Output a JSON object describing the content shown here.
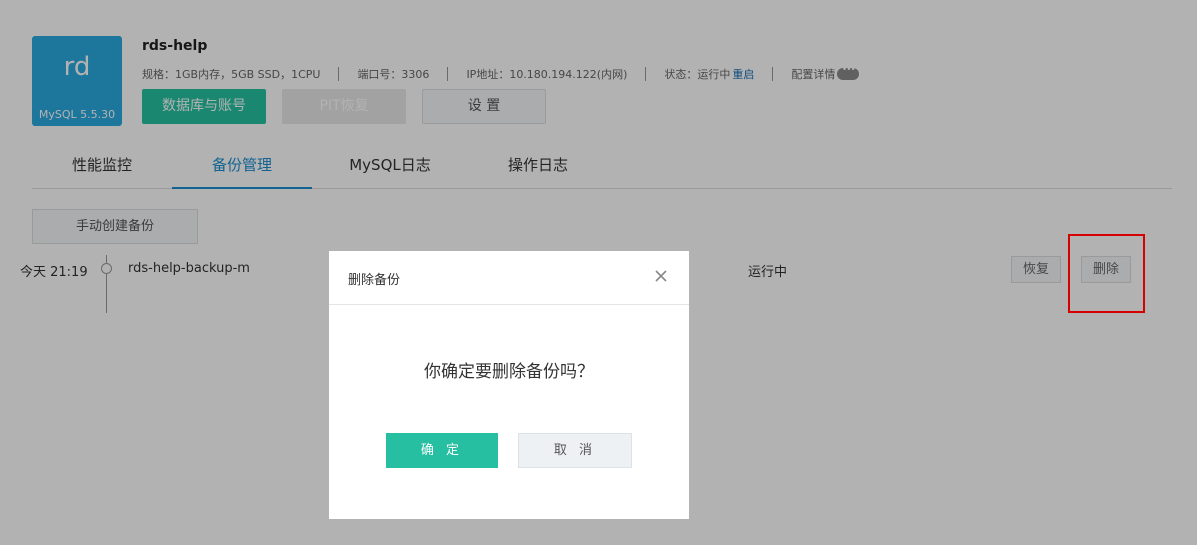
{
  "instance": {
    "logo_abbr": "rd",
    "engine": "MySQL 5.5.30",
    "name": "rds-help",
    "spec": "规格：1GB内存，5GB SSD，1CPU",
    "port": "端口号：3306",
    "ip": "IP地址：10.180.194.122(内网)",
    "status_label": "状态：运行中",
    "restart_link": "重启",
    "config_details": "配置详情"
  },
  "actions": {
    "db_accounts": "数据库与账号",
    "pit_restore": "PIT恢复",
    "settings": "设 置"
  },
  "tabs": [
    {
      "label": "性能监控",
      "active": false
    },
    {
      "label": "备份管理",
      "active": true
    },
    {
      "label": "MySQL日志",
      "active": false
    },
    {
      "label": "操作日志",
      "active": false
    }
  ],
  "backup": {
    "manual_create": "手动创建备份",
    "rows": [
      {
        "time": "今天 21:19",
        "name": "rds-help-backup-m",
        "status": "运行中",
        "restore": "恢复",
        "delete": "删除"
      }
    ]
  },
  "modal": {
    "title": "删除备份",
    "close_icon": "close-icon",
    "message": "你确定要删除备份吗？",
    "confirm": "确 定",
    "cancel": "取 消"
  },
  "colors": {
    "logo_bg": "#2aa9e0",
    "primary_green": "#26c3a3",
    "tab_active": "#1a8fd0",
    "link": "#1a6fb5",
    "highlight": "#d50000"
  }
}
